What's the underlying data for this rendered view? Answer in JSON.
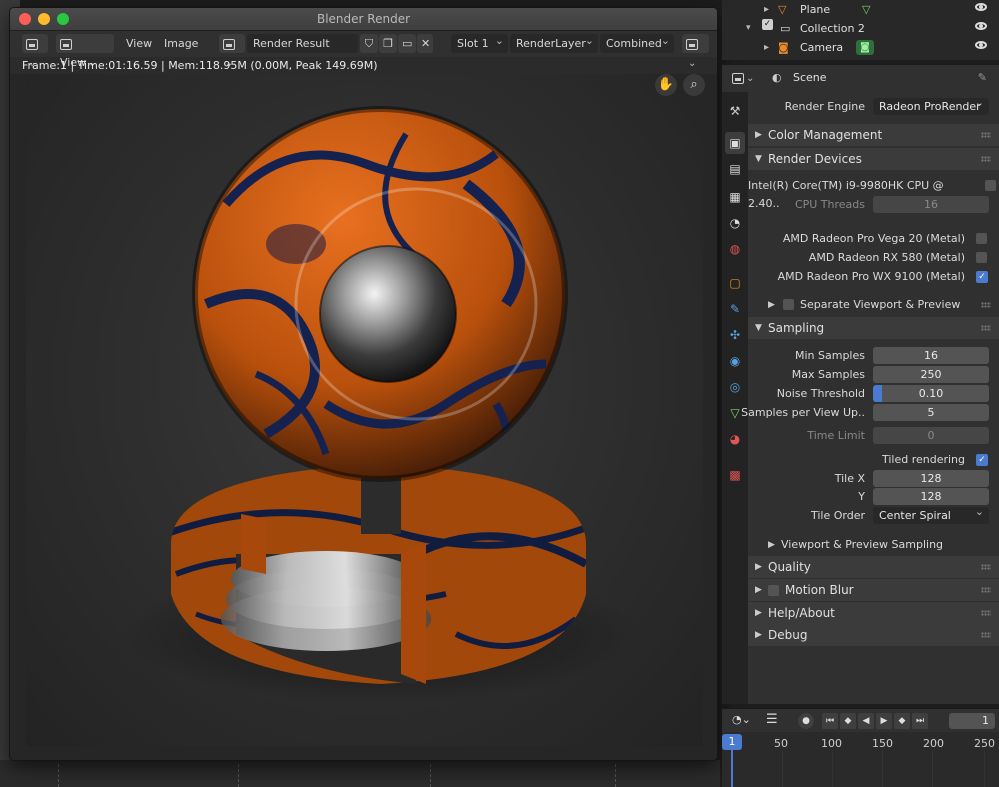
{
  "window": {
    "title": "Blender Render",
    "info_text": "Frame:1 | Time:01:16.59 | Mem:118.95M (0.00M, Peak 149.69M)"
  },
  "toolbar": {
    "view_menu_1": "View",
    "view_menu_2": "View",
    "image_menu": "Image",
    "image_name": "Render Result",
    "slot": "Slot 1",
    "layer": "RenderLayer",
    "pass": "Combined"
  },
  "outliner": {
    "rows": [
      {
        "label": "Plane"
      },
      {
        "label": "Collection 2"
      },
      {
        "label": "Camera"
      }
    ]
  },
  "properties": {
    "context": "Scene",
    "render_engine_label": "Render Engine",
    "render_engine_value": "Radeon ProRender",
    "color_management": "Color Management",
    "render_devices": "Render Devices",
    "cpu_name": "Intel(R) Core(TM) i9-9980HK CPU @ 2.40..",
    "cpu_threads_label": "CPU Threads",
    "cpu_threads_value": "16",
    "gpu1": "AMD Radeon Pro Vega 20 (Metal)",
    "gpu2": "AMD Radeon RX 580 (Metal)",
    "gpu3": "AMD Radeon Pro WX 9100 (Metal)",
    "separate_viewport": "Separate Viewport & Preview Devices",
    "sampling": "Sampling",
    "min_samples_label": "Min Samples",
    "min_samples": "16",
    "max_samples_label": "Max Samples",
    "max_samples": "250",
    "noise_threshold_label": "Noise Threshold",
    "noise_threshold": "0.10",
    "spv_label": "Samples per View Up..",
    "spv": "5",
    "time_limit_label": "Time Limit",
    "time_limit": "0",
    "tiled_rendering": "Tiled rendering",
    "tile_x_label": "Tile X",
    "tile_x": "128",
    "tile_y_label": "Y",
    "tile_y": "128",
    "tile_order_label": "Tile Order",
    "tile_order": "Center Spiral",
    "viewport_sampling": "Viewport & Preview Sampling",
    "quality": "Quality",
    "motion_blur": "Motion Blur",
    "help_about": "Help/About",
    "debug": "Debug"
  },
  "timeline": {
    "current_frame": "1",
    "ticks": [
      "1",
      "50",
      "100",
      "150",
      "200",
      "250"
    ]
  },
  "colors": {
    "accent_blue": "#4b7ad1",
    "orange": "#d4600f",
    "navy_swirl": "#1a2a5a"
  }
}
